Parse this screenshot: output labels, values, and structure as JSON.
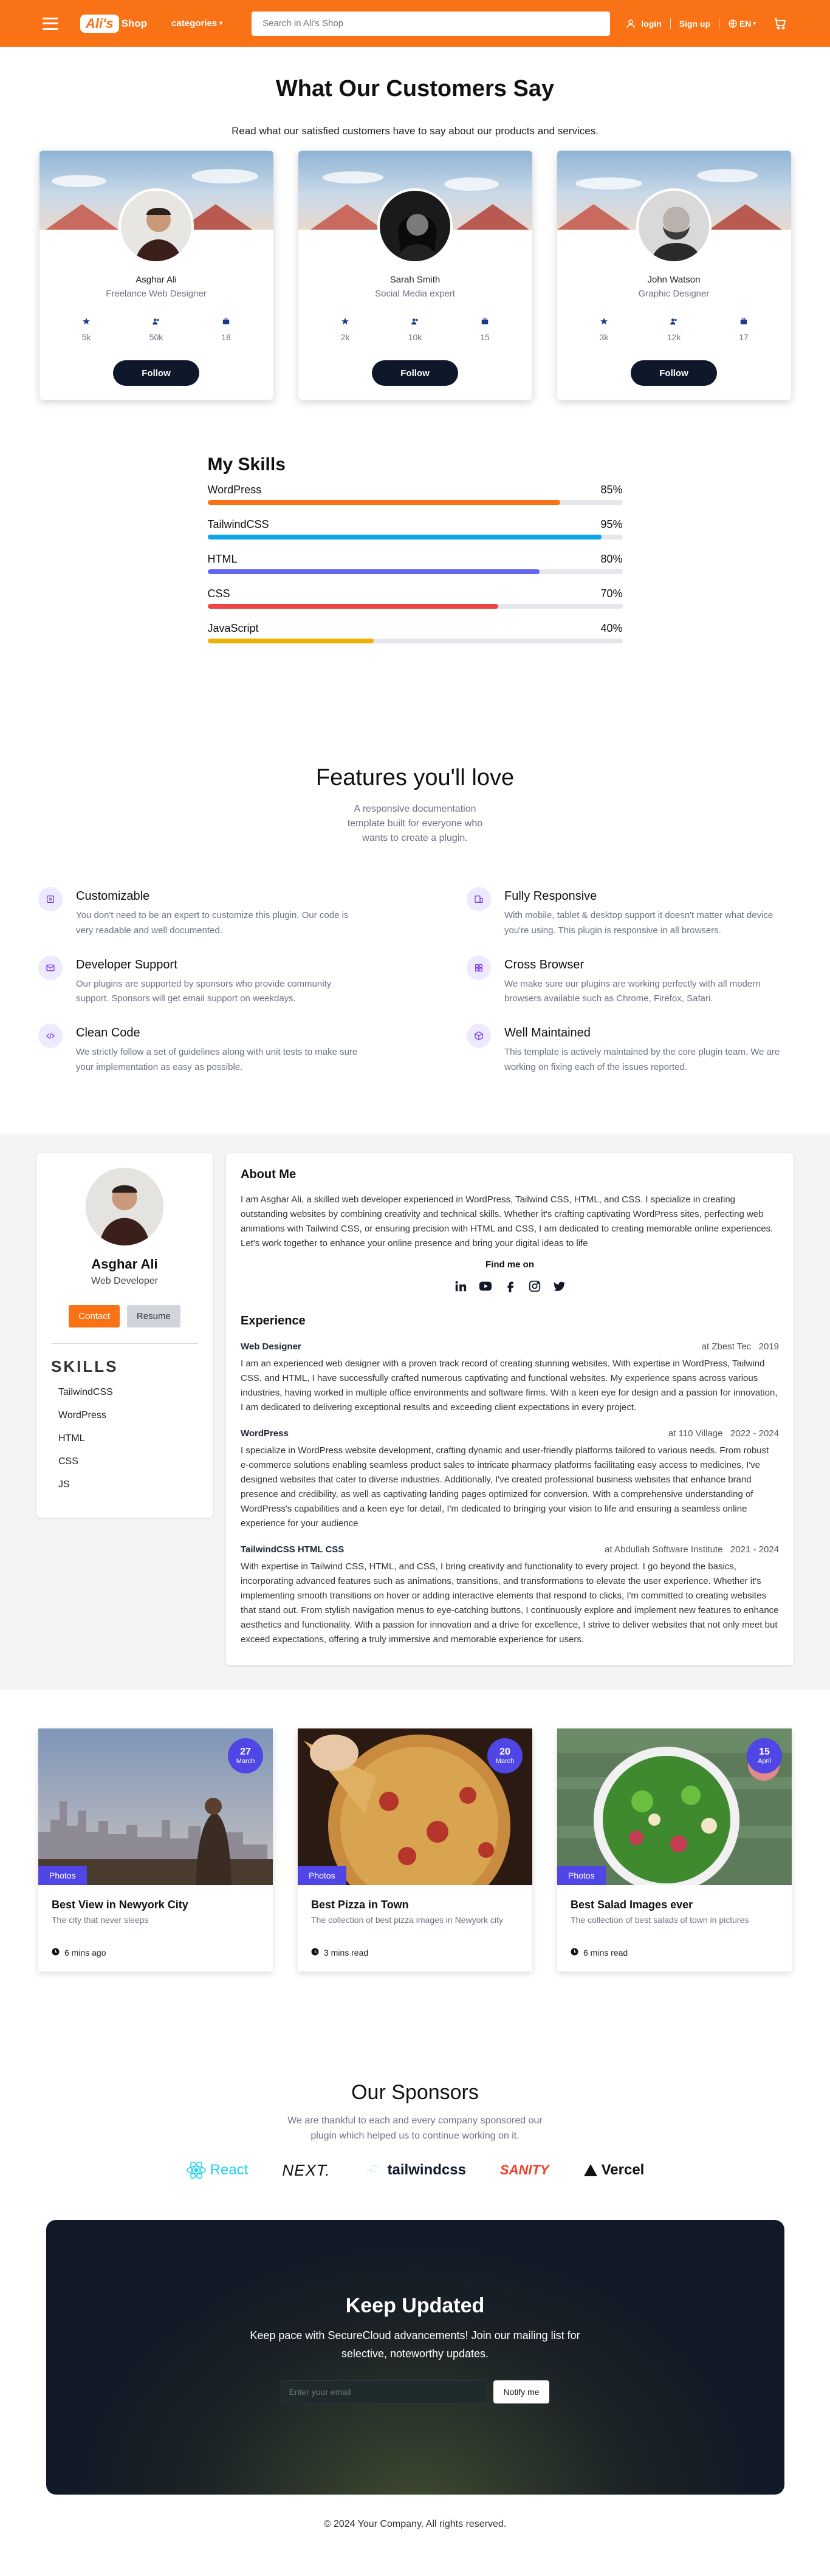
{
  "nav": {
    "logo_pill": "Ali's",
    "logo_text": "Shop",
    "categories": "categories",
    "search_placeholder": "Search in Ali's Shop",
    "login": "login",
    "signup": "Sign up",
    "lang": "EN"
  },
  "testimonials": {
    "title": "What Our Customers Say",
    "subtitle": "Read what our satisfied customers have to say about our products and services.",
    "follow": "Follow",
    "cards": [
      {
        "name": "Asghar Ali",
        "role": "Freelance Web Designer",
        "s1": "5k",
        "s2": "50k",
        "s3": "18"
      },
      {
        "name": "Sarah Smith",
        "role": "Social Media expert",
        "s1": "2k",
        "s2": "10k",
        "s3": "15"
      },
      {
        "name": "John Watson",
        "role": "Graphic Designer",
        "s1": "3k",
        "s2": "12k",
        "s3": "17"
      }
    ]
  },
  "skills": {
    "title": "My Skills",
    "items": [
      {
        "name": "WordPress",
        "label": "85%",
        "value": 0.85,
        "color": "#f97316"
      },
      {
        "name": "TailwindCSS",
        "label": "95%",
        "value": 0.95,
        "color": "#0ea5e9"
      },
      {
        "name": "HTML",
        "label": "80%",
        "value": 0.8,
        "color": "#6366f1"
      },
      {
        "name": "CSS",
        "label": "70%",
        "value": 0.7,
        "color": "#ef4444"
      },
      {
        "name": "JavaScript",
        "label": "40%",
        "value": 0.4,
        "color": "#eab308"
      }
    ]
  },
  "features": {
    "title": "Features you'll love",
    "subtitle": "A responsive documentation template built for everyone who wants to create a plugin.",
    "items": [
      {
        "title": "Customizable",
        "text": "You don't need to be an expert to customize this plugin. Our code is very readable and well documented.",
        "icon": "customize-icon"
      },
      {
        "title": "Fully Responsive",
        "text": "With mobile, tablet & desktop support it doesn't matter what device you're using. This plugin is responsive in all browsers.",
        "icon": "device-icon"
      },
      {
        "title": "Developer Support",
        "text": "Our plugins are supported by sponsors who provide community support. Sponsors will get email support on weekdays.",
        "icon": "mail-icon"
      },
      {
        "title": "Cross Browser",
        "text": "We make sure our plugins are working perfectly with all modern browsers available such as Chrome, Firefox, Safari.",
        "icon": "browser-icon"
      },
      {
        "title": "Clean Code",
        "text": "We strictly follow a set of guidelines along with unit tests to make sure your implementation as easy as possible.",
        "icon": "code-icon"
      },
      {
        "title": "Well Maintained",
        "text": "This template is actively maintained by the core plugin team. We are working on fixing each of the issues reported.",
        "icon": "cube-icon"
      }
    ]
  },
  "profile": {
    "name": "Asghar Ali",
    "role": "Web Developer",
    "contact": "Contact",
    "resume": "Resume",
    "skills_title": "SKILLS",
    "skills": [
      "TailwindCSS",
      "WordPress",
      "HTML",
      "CSS",
      "JS"
    ],
    "about_title": "About Me",
    "about": "I am Asghar Ali, a skilled web developer experienced in WordPress, Tailwind CSS, HTML, and CSS. I specialize in creating outstanding websites by combining creativity and technical skills. Whether it's crafting captivating WordPress sites, perfecting web animations with Tailwind CSS, or ensuring precision with HTML and CSS, I am dedicated to creating memorable online experiences. Let's work together to enhance your online presence and bring your digital ideas to life",
    "find": "Find me on",
    "exp_title": "Experience",
    "jobs": [
      {
        "title": "Web Designer",
        "meta": "at Zbest Tec   2019",
        "text": "I am an experienced web designer with a proven track record of creating stunning websites. With expertise in WordPress, Tailwind CSS, and HTML, I have successfully crafted numerous captivating and functional websites. My experience spans across various industries, having worked in multiple office environments and software firms. With a keen eye for design and a passion for innovation, I am dedicated to delivering exceptional results and exceeding client expectations in every project."
      },
      {
        "title": "WordPress",
        "meta": "at 110 Village   2022 - 2024",
        "text": "I specialize in WordPress website development, crafting dynamic and user-friendly platforms tailored to various needs. From robust e-commerce solutions enabling seamless product sales to intricate pharmacy platforms facilitating easy access to medicines, I've designed websites that cater to diverse industries. Additionally, I've created professional business websites that enhance brand presence and credibility, as well as captivating landing pages optimized for conversion. With a comprehensive understanding of WordPress's capabilities and a keen eye for detail, I'm dedicated to bringing your vision to life and ensuring a seamless online experience for your audience"
      },
      {
        "title": "TailwindCSS HTML CSS",
        "meta": "at Abdullah Software Institute   2021 - 2024",
        "text": "With expertise in Tailwind CSS, HTML, and CSS, I bring creativity and functionality to every project. I go beyond the basics, incorporating advanced features such as animations, transitions, and transformations to elevate the user experience. Whether it's implementing smooth transitions on hover or adding interactive elements that respond to clicks, I'm committed to creating websites that stand out. From stylish navigation menus to eye-catching buttons, I continuously explore and implement new features to enhance aesthetics and functionality. With a passion for innovation and a drive for excellence, I strive to deliver websites that not only meet but exceed expectations, offering a truly immersive and memorable experience for users."
      }
    ]
  },
  "blog": [
    {
      "day": "27",
      "month": "March",
      "tag": "Photos",
      "title": "Best View in Newyork City",
      "desc": "The city that never sleeps",
      "time": "6 mins ago"
    },
    {
      "day": "20",
      "month": "March",
      "tag": "Photos",
      "title": "Best Pizza in Town",
      "desc": "The collection of best pizza images in Newyork city",
      "time": "3 mins read"
    },
    {
      "day": "15",
      "month": "April",
      "tag": "Photos",
      "title": "Best Salad Images ever",
      "desc": "The collection of best salads of town in pictures",
      "time": "6 mins read"
    }
  ],
  "sponsors": {
    "title": "Our Sponsors",
    "subtitle": "We are thankful to each and every company sponsored our plugin which helped us to continue working on it.",
    "logos": [
      "React",
      "NEXT.",
      "tailwindcss",
      "SANITY",
      "Vercel"
    ]
  },
  "newsletter": {
    "title": "Keep Updated",
    "text": "Keep pace with SecureCloud advancements! Join our mailing list for selective, noteworthy updates.",
    "placeholder": "Enter your email",
    "button": "Notify me"
  },
  "footer": "© 2024 Your Company. All rights reserved."
}
